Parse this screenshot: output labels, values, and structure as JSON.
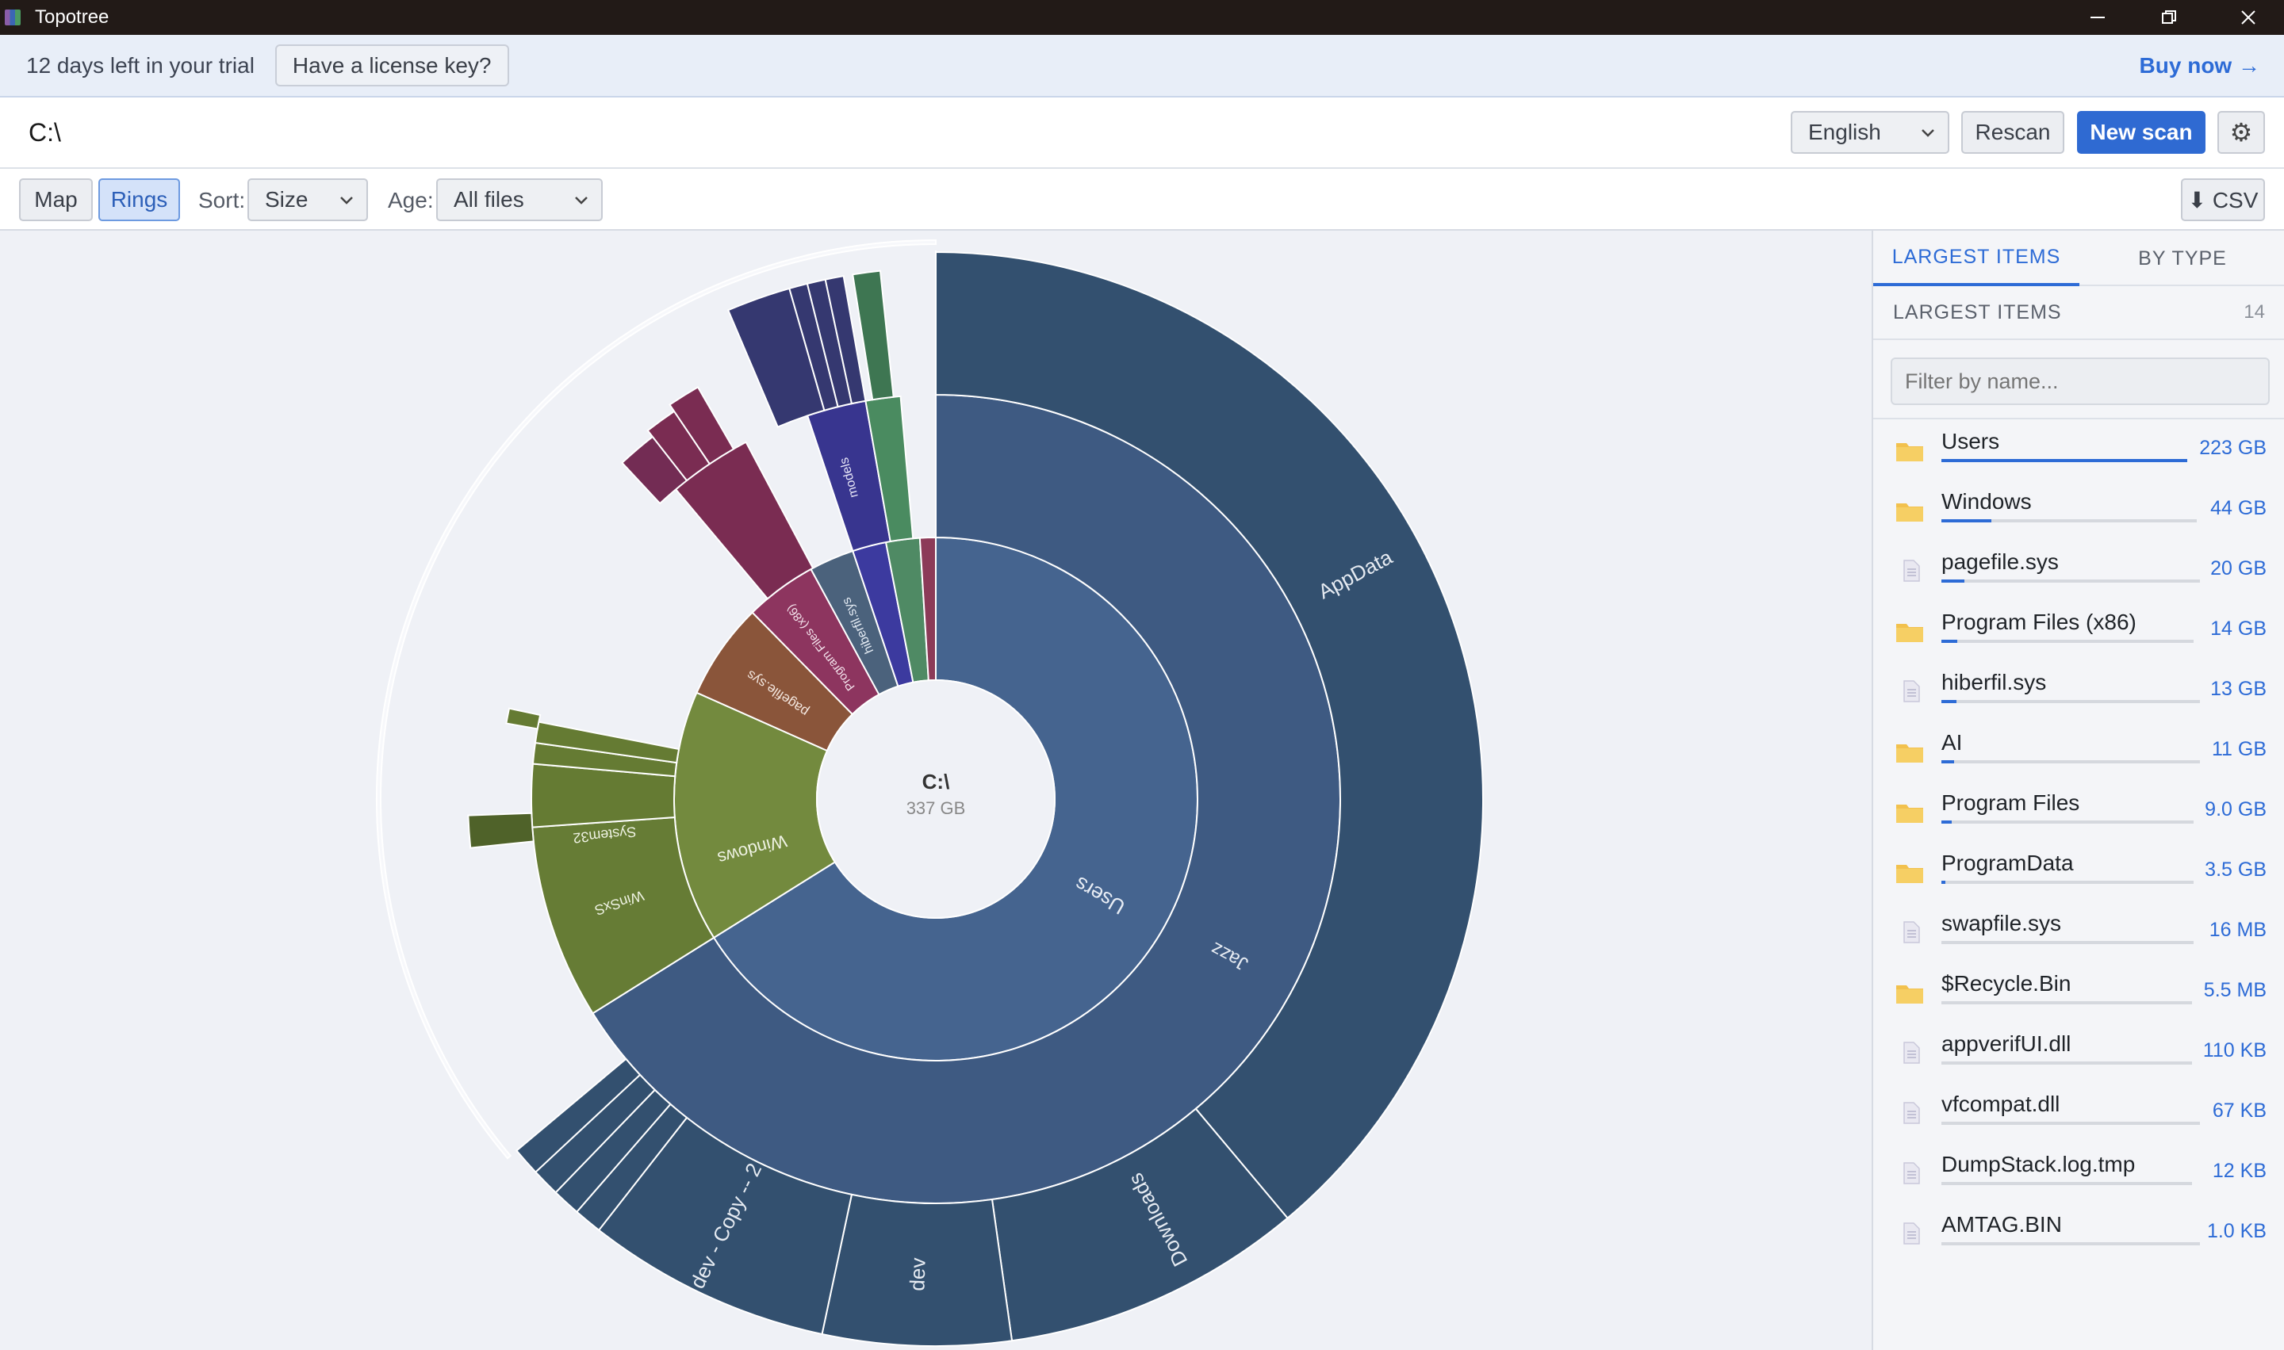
{
  "window": {
    "title": "Topotree",
    "controls": {
      "minimize": "─",
      "restore": "❐",
      "close": "✕"
    }
  },
  "trial_banner": {
    "message": "12 days left in your trial",
    "license_button": "Have a license key?",
    "buy_link": "Buy now →"
  },
  "path_bar": {
    "path": "C:\\",
    "language": "English",
    "rescan": "Rescan",
    "new_scan": "New scan",
    "settings_icon": "⚙"
  },
  "toolbar": {
    "view_map": "Map",
    "view_rings": "Rings",
    "active_view": "Rings",
    "sort_label": "Sort:",
    "sort_value": "Size",
    "age_label": "Age:",
    "age_value": "All files",
    "csv": "⬇ CSV"
  },
  "chart": {
    "center_label": "C:\\",
    "center_size": "337 GB",
    "ring_labels": {
      "users": "Users",
      "jazz": "Jazz",
      "appdata": "AppData",
      "downloads": "Downloads",
      "dev": "dev",
      "dev_copy": "dev - Copy -- 2",
      "windows": "Windows",
      "system32": "System32",
      "winsxs": "WinSxS",
      "pagefile": "pagefile.sys",
      "program_files_x86": "Program Files (x86)",
      "hiberfil": "hiberfil.sys",
      "models": "models"
    }
  },
  "chart_data": {
    "type": "sunburst",
    "unit": "GB",
    "root": {
      "name": "C:\\",
      "size": 337
    },
    "level1": [
      {
        "name": "Users",
        "size": 223,
        "color": "#45648f"
      },
      {
        "name": "Windows",
        "size": 44,
        "color": "#738a3e"
      },
      {
        "name": "pagefile.sys",
        "size": 20,
        "color": "#8a553a"
      },
      {
        "name": "Program Files (x86)",
        "size": 14,
        "color": "#8d355f"
      },
      {
        "name": "hiberfil.sys",
        "size": 13,
        "color": "#4b627c"
      },
      {
        "name": "AI",
        "size": 11,
        "color": "#3c3a9f"
      },
      {
        "name": "Program Files",
        "size": 9.0,
        "color": "#4f8a64"
      },
      {
        "name": "ProgramData",
        "size": 3.5,
        "color": "#8c3a58"
      }
    ]
  },
  "sidebar": {
    "tab_largest": "LARGEST ITEMS",
    "tab_type": "BY TYPE",
    "list_title": "LARGEST ITEMS",
    "count": "14",
    "filter_placeholder": "Filter by name...",
    "items": [
      {
        "name": "Users",
        "size": "223 GB",
        "kind": "folder",
        "fraction": 1.0
      },
      {
        "name": "Windows",
        "size": "44 GB",
        "kind": "folder",
        "fraction": 0.197
      },
      {
        "name": "pagefile.sys",
        "size": "20 GB",
        "kind": "file",
        "fraction": 0.09
      },
      {
        "name": "Program Files (x86)",
        "size": "14 GB",
        "kind": "folder",
        "fraction": 0.063
      },
      {
        "name": "hiberfil.sys",
        "size": "13 GB",
        "kind": "file",
        "fraction": 0.058
      },
      {
        "name": "AI",
        "size": "11 GB",
        "kind": "folder",
        "fraction": 0.049
      },
      {
        "name": "Program Files",
        "size": "9.0 GB",
        "kind": "folder",
        "fraction": 0.04
      },
      {
        "name": "ProgramData",
        "size": "3.5 GB",
        "kind": "folder",
        "fraction": 0.016
      },
      {
        "name": "swapfile.sys",
        "size": "16 MB",
        "kind": "file",
        "fraction": 0.0
      },
      {
        "name": "$Recycle.Bin",
        "size": "5.5 MB",
        "kind": "folder",
        "fraction": 0.0
      },
      {
        "name": "appverifUI.dll",
        "size": "110 KB",
        "kind": "file",
        "fraction": 0.0
      },
      {
        "name": "vfcompat.dll",
        "size": "67 KB",
        "kind": "file",
        "fraction": 0.0
      },
      {
        "name": "DumpStack.log.tmp",
        "size": "12 KB",
        "kind": "file",
        "fraction": 0.0
      },
      {
        "name": "AMTAG.BIN",
        "size": "1.0 KB",
        "kind": "file",
        "fraction": 0.0
      }
    ]
  }
}
